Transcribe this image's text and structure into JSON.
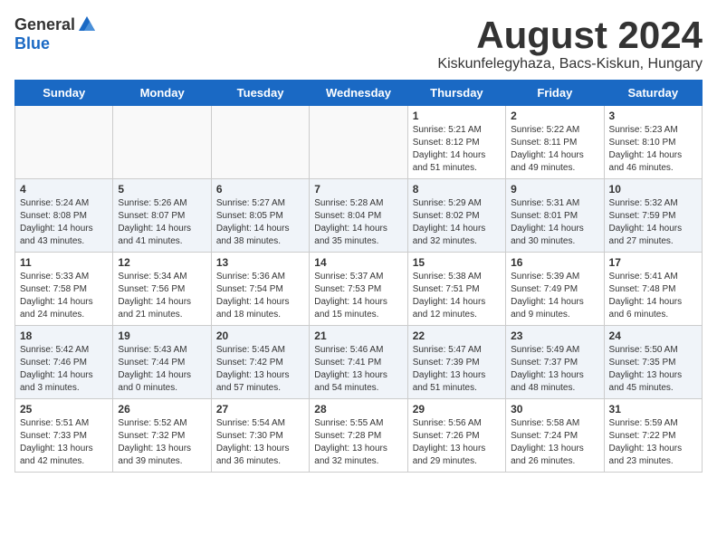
{
  "logo": {
    "general": "General",
    "blue": "Blue"
  },
  "title": "August 2024",
  "subtitle": "Kiskunfelegyhaza, Bacs-Kiskun, Hungary",
  "weekdays": [
    "Sunday",
    "Monday",
    "Tuesday",
    "Wednesday",
    "Thursday",
    "Friday",
    "Saturday"
  ],
  "weeks": [
    [
      {
        "day": "",
        "info": ""
      },
      {
        "day": "",
        "info": ""
      },
      {
        "day": "",
        "info": ""
      },
      {
        "day": "",
        "info": ""
      },
      {
        "day": "1",
        "info": "Sunrise: 5:21 AM\nSunset: 8:12 PM\nDaylight: 14 hours\nand 51 minutes."
      },
      {
        "day": "2",
        "info": "Sunrise: 5:22 AM\nSunset: 8:11 PM\nDaylight: 14 hours\nand 49 minutes."
      },
      {
        "day": "3",
        "info": "Sunrise: 5:23 AM\nSunset: 8:10 PM\nDaylight: 14 hours\nand 46 minutes."
      }
    ],
    [
      {
        "day": "4",
        "info": "Sunrise: 5:24 AM\nSunset: 8:08 PM\nDaylight: 14 hours\nand 43 minutes."
      },
      {
        "day": "5",
        "info": "Sunrise: 5:26 AM\nSunset: 8:07 PM\nDaylight: 14 hours\nand 41 minutes."
      },
      {
        "day": "6",
        "info": "Sunrise: 5:27 AM\nSunset: 8:05 PM\nDaylight: 14 hours\nand 38 minutes."
      },
      {
        "day": "7",
        "info": "Sunrise: 5:28 AM\nSunset: 8:04 PM\nDaylight: 14 hours\nand 35 minutes."
      },
      {
        "day": "8",
        "info": "Sunrise: 5:29 AM\nSunset: 8:02 PM\nDaylight: 14 hours\nand 32 minutes."
      },
      {
        "day": "9",
        "info": "Sunrise: 5:31 AM\nSunset: 8:01 PM\nDaylight: 14 hours\nand 30 minutes."
      },
      {
        "day": "10",
        "info": "Sunrise: 5:32 AM\nSunset: 7:59 PM\nDaylight: 14 hours\nand 27 minutes."
      }
    ],
    [
      {
        "day": "11",
        "info": "Sunrise: 5:33 AM\nSunset: 7:58 PM\nDaylight: 14 hours\nand 24 minutes."
      },
      {
        "day": "12",
        "info": "Sunrise: 5:34 AM\nSunset: 7:56 PM\nDaylight: 14 hours\nand 21 minutes."
      },
      {
        "day": "13",
        "info": "Sunrise: 5:36 AM\nSunset: 7:54 PM\nDaylight: 14 hours\nand 18 minutes."
      },
      {
        "day": "14",
        "info": "Sunrise: 5:37 AM\nSunset: 7:53 PM\nDaylight: 14 hours\nand 15 minutes."
      },
      {
        "day": "15",
        "info": "Sunrise: 5:38 AM\nSunset: 7:51 PM\nDaylight: 14 hours\nand 12 minutes."
      },
      {
        "day": "16",
        "info": "Sunrise: 5:39 AM\nSunset: 7:49 PM\nDaylight: 14 hours\nand 9 minutes."
      },
      {
        "day": "17",
        "info": "Sunrise: 5:41 AM\nSunset: 7:48 PM\nDaylight: 14 hours\nand 6 minutes."
      }
    ],
    [
      {
        "day": "18",
        "info": "Sunrise: 5:42 AM\nSunset: 7:46 PM\nDaylight: 14 hours\nand 3 minutes."
      },
      {
        "day": "19",
        "info": "Sunrise: 5:43 AM\nSunset: 7:44 PM\nDaylight: 14 hours\nand 0 minutes."
      },
      {
        "day": "20",
        "info": "Sunrise: 5:45 AM\nSunset: 7:42 PM\nDaylight: 13 hours\nand 57 minutes."
      },
      {
        "day": "21",
        "info": "Sunrise: 5:46 AM\nSunset: 7:41 PM\nDaylight: 13 hours\nand 54 minutes."
      },
      {
        "day": "22",
        "info": "Sunrise: 5:47 AM\nSunset: 7:39 PM\nDaylight: 13 hours\nand 51 minutes."
      },
      {
        "day": "23",
        "info": "Sunrise: 5:49 AM\nSunset: 7:37 PM\nDaylight: 13 hours\nand 48 minutes."
      },
      {
        "day": "24",
        "info": "Sunrise: 5:50 AM\nSunset: 7:35 PM\nDaylight: 13 hours\nand 45 minutes."
      }
    ],
    [
      {
        "day": "25",
        "info": "Sunrise: 5:51 AM\nSunset: 7:33 PM\nDaylight: 13 hours\nand 42 minutes."
      },
      {
        "day": "26",
        "info": "Sunrise: 5:52 AM\nSunset: 7:32 PM\nDaylight: 13 hours\nand 39 minutes."
      },
      {
        "day": "27",
        "info": "Sunrise: 5:54 AM\nSunset: 7:30 PM\nDaylight: 13 hours\nand 36 minutes."
      },
      {
        "day": "28",
        "info": "Sunrise: 5:55 AM\nSunset: 7:28 PM\nDaylight: 13 hours\nand 32 minutes."
      },
      {
        "day": "29",
        "info": "Sunrise: 5:56 AM\nSunset: 7:26 PM\nDaylight: 13 hours\nand 29 minutes."
      },
      {
        "day": "30",
        "info": "Sunrise: 5:58 AM\nSunset: 7:24 PM\nDaylight: 13 hours\nand 26 minutes."
      },
      {
        "day": "31",
        "info": "Sunrise: 5:59 AM\nSunset: 7:22 PM\nDaylight: 13 hours\nand 23 minutes."
      }
    ]
  ]
}
